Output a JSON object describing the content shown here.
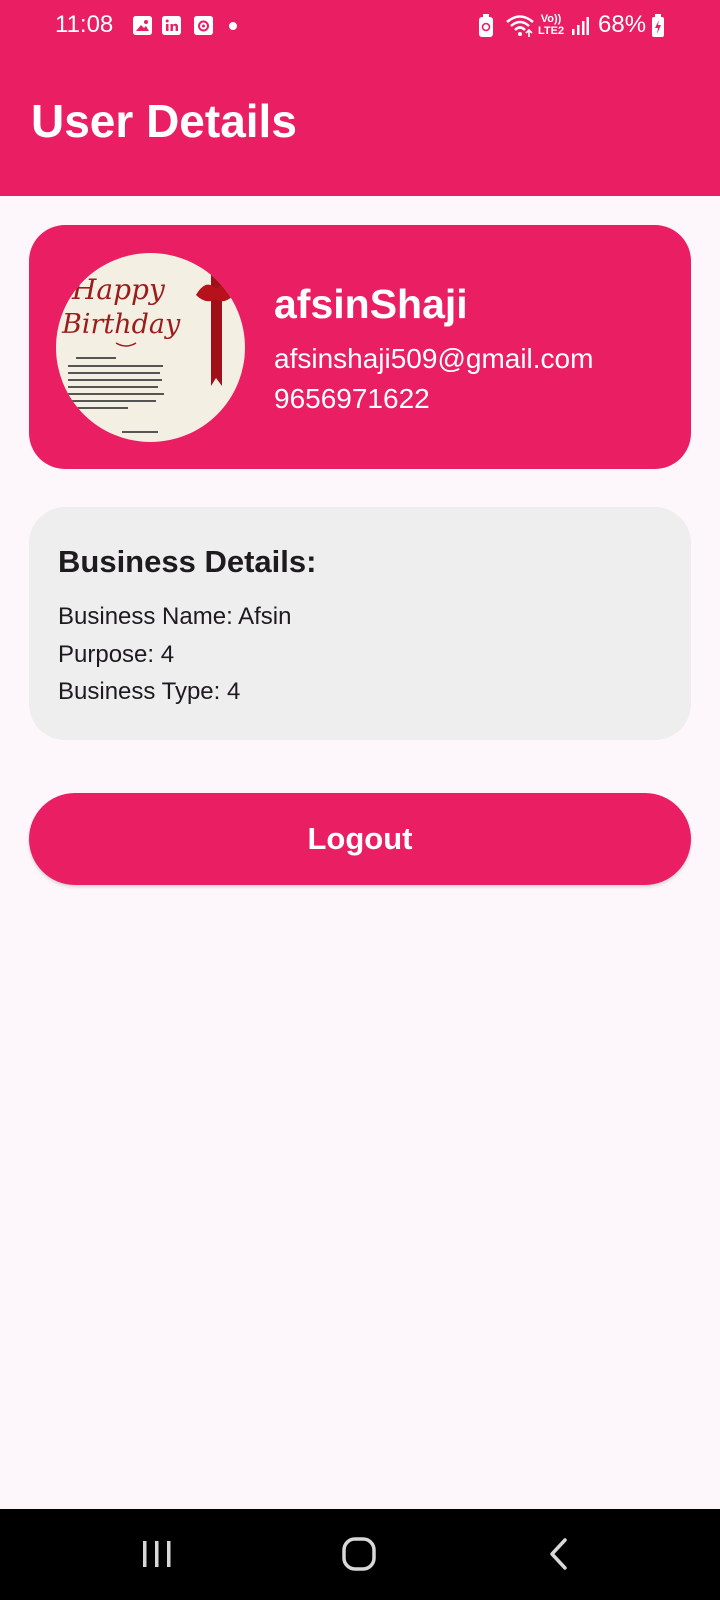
{
  "status_bar": {
    "time": "11:08",
    "battery": "68%",
    "network_label_top": "Vo))",
    "network_label_bottom": "LTE2",
    "notification_icons": [
      "gallery-icon",
      "linkedin-icon",
      "media-icon"
    ]
  },
  "app_bar": {
    "title": "User Details"
  },
  "profile": {
    "name": "afsinShaji",
    "email": "afsinshaji509@gmail.com",
    "phone": "9656971622",
    "avatar_text_line1": "Happy",
    "avatar_text_line2": "Birthday"
  },
  "business": {
    "heading": "Business Details:",
    "name_line": "Business Name: Afsin",
    "purpose_line": "Purpose: 4",
    "type_line": "Business Type: 4"
  },
  "actions": {
    "logout_label": "Logout"
  },
  "colors": {
    "primary": "#e91e63",
    "card_grey": "#eeeeee",
    "background": "#fdf7fc",
    "nav": "#000000"
  }
}
